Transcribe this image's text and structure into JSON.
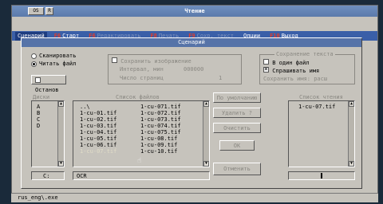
{
  "window": {
    "title": "Чтение"
  },
  "sysbuttons": [
    "OS",
    "R"
  ],
  "menu": {
    "items": [
      {
        "key": "",
        "label": "Сценарий",
        "selected": true
      },
      {
        "key": "F6",
        "label": "Старт",
        "bright": true
      },
      {
        "key": "F6",
        "label": "Редактировать",
        "dim": true
      },
      {
        "key": "F8",
        "label": "Печать",
        "dim": true
      },
      {
        "key": "F9",
        "label": "Сохр. текст",
        "dim": true
      },
      {
        "key": "",
        "label": "Опции",
        "bright": true
      },
      {
        "key": "F10",
        "label": "Выход",
        "bright": true
      }
    ]
  },
  "dialog": {
    "title": "Сценарий",
    "mode": {
      "scan": "Сканировать",
      "read": "Читать файл"
    },
    "stop_button": "Останов",
    "options": {
      "nonstandard": "Сохранить изображение",
      "interval_label": "Интервал, мин",
      "interval_value": "000000",
      "pages_label": "Число страниц",
      "pages_value": "1"
    },
    "save_group": {
      "title": "Сохранение текста",
      "one_file": "В один файл",
      "ask_name": "Спрашивать имя",
      "save_label": "Сохранить имя: расш"
    },
    "drives_header": "Диски",
    "drives": [
      "A",
      "B",
      "C",
      "D"
    ],
    "files_header": "Список файлов",
    "files": [
      [
        "..\\",
        "1-cu-071.tif"
      ],
      [
        "1-cu-01.tif",
        "1-cu-072.tif"
      ],
      [
        "1-cu-02.tif",
        "1-cu-073.tif"
      ],
      [
        "1-cu-03.tif",
        "1-cu-074.tif"
      ],
      [
        "1-cu-04.tif",
        "1-cu-075.tif"
      ],
      [
        "1-cu-05.tif",
        "1-cu-08.tif"
      ],
      [
        "1-cu-06.tif",
        "1-cu-09.tif"
      ],
      [
        "1-cu-07.tif",
        "1-cu-10.tif"
      ]
    ],
    "selected_file_row": 7,
    "buttons": {
      "default": "По умолчанию",
      "delete": "Удалить ?",
      "clear": "Очистить",
      "ok": "ОК",
      "cancel": "Отменить"
    },
    "queue_header": "Список чтения",
    "queue": [
      "1-cu-07.tif"
    ],
    "path_drive": "C:",
    "path_dir": "OCR"
  },
  "status": {
    "text": "rus_eng\\.exe"
  }
}
